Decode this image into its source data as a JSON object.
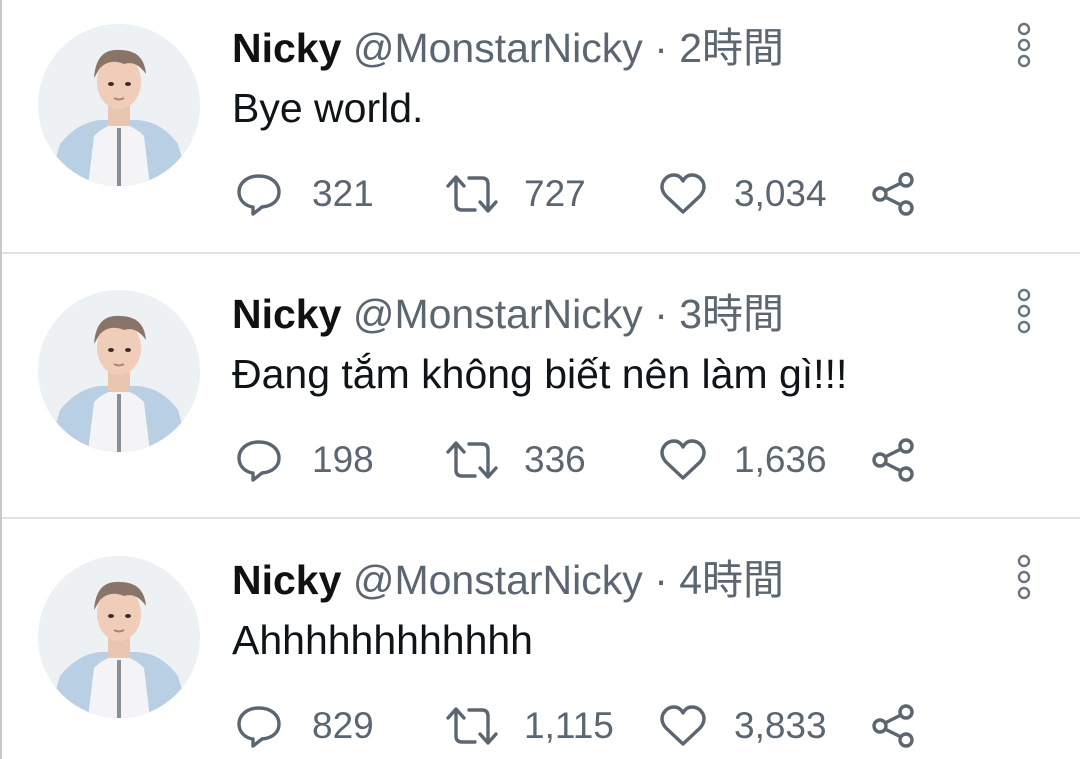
{
  "tweets": [
    {
      "name": "Nicky",
      "handle": "@MonstarNicky",
      "separator": "·",
      "time": "2時間",
      "text": "Bye world.",
      "replies": "321",
      "retweets": "727",
      "likes": "3,034"
    },
    {
      "name": "Nicky",
      "handle": "@MonstarNicky",
      "separator": "·",
      "time": "3時間",
      "text": "Đang tắm không biết nên làm gì!!!",
      "replies": "198",
      "retweets": "336",
      "likes": "1,636"
    },
    {
      "name": "Nicky",
      "handle": "@MonstarNicky",
      "separator": "·",
      "time": "4時間",
      "text": "Ahhhhhhhhhhhh",
      "replies": "829",
      "retweets": "1,115",
      "likes": "3,833"
    }
  ],
  "icons": {
    "reply": "reply-icon",
    "retweet": "retweet-icon",
    "like": "heart-icon",
    "share": "share-icon",
    "more": "more-options-icon"
  },
  "colors": {
    "text": "#0f1419",
    "secondary": "#5b6670",
    "divider": "#e2e2e2"
  }
}
